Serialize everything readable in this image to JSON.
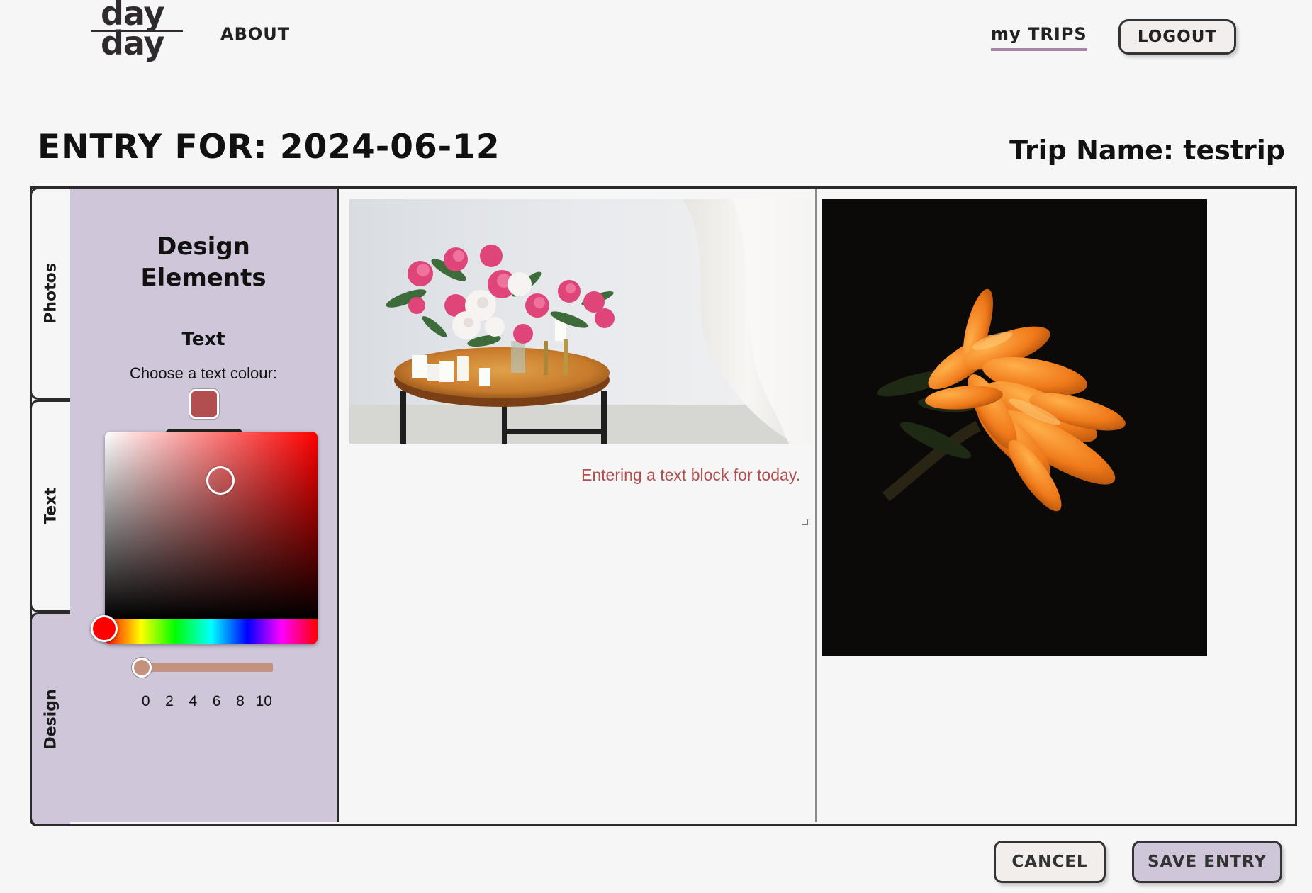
{
  "header": {
    "logo_word_top": "day",
    "logo_word_bottom": "day",
    "nav_about": "ABOUT",
    "nav_my_trips": "my TRIPS",
    "logout_label": "LOGOUT"
  },
  "entry": {
    "title": "ENTRY FOR: 2024-06-12",
    "trip_name": "Trip Name: testrip"
  },
  "sidebar_tabs": [
    "Photos",
    "Text",
    "Design"
  ],
  "design_panel": {
    "title_line1": "Design",
    "title_line2": "Elements",
    "section": "Text",
    "colour_prompt": "Choose a text colour:",
    "selected_colour": "#b24d50",
    "size_ticks": [
      "0",
      "2",
      "4",
      "6",
      "8",
      "10"
    ],
    "size_value": 0
  },
  "canvas": {
    "text_block": "Entering a text block for today.",
    "text_colour": "#b24d50",
    "photos": [
      "pink-and-white-flowers-on-table",
      "orange-flower-on-black"
    ]
  },
  "footer": {
    "cancel_label": "CANCEL",
    "save_label": "SAVE ENTRY"
  },
  "colors": {
    "accent_lavender": "#cfc6d9",
    "nav_underline": "#a684a6",
    "slider": "#c4917e"
  }
}
